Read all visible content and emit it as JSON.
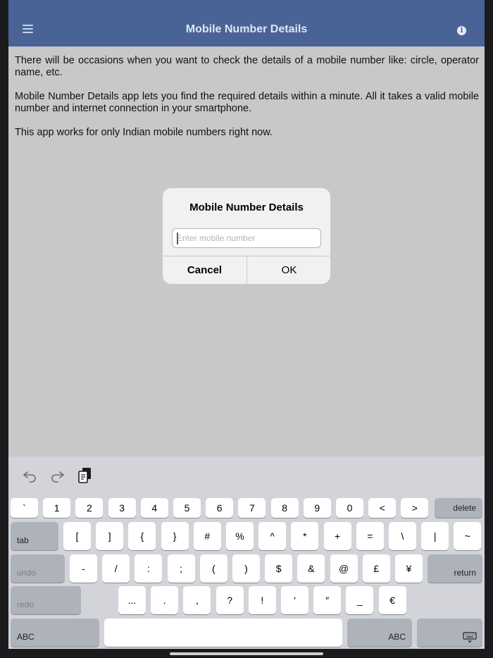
{
  "header": {
    "title": "Mobile Number Details"
  },
  "content": {
    "paragraphs": [
      "There will be occasions when you want to check the details of a mobile number like: circle, operator name, etc.",
      "Mobile Number Details app lets you find the required details within a minute. All it takes a valid mobile number and internet connection in your smartphone.",
      "This app works for only Indian mobile numbers right now."
    ]
  },
  "dialog": {
    "title": "Mobile Number Details",
    "input_value": "",
    "input_placeholder": "Enter mobile number",
    "cancel_label": "Cancel",
    "ok_label": "OK"
  },
  "keyboard": {
    "row1": [
      "`",
      "1",
      "2",
      "3",
      "4",
      "5",
      "6",
      "7",
      "8",
      "9",
      "0",
      "<",
      ">"
    ],
    "delete_label": "delete",
    "tab_label": "tab",
    "row2": [
      "[",
      "]",
      "{",
      "}",
      "#",
      "%",
      "^",
      "*",
      "+",
      "=",
      "\\",
      "|",
      "~"
    ],
    "undo_label": "undo",
    "row3": [
      "-",
      "/",
      ":",
      ";",
      "(",
      ")",
      "$",
      "&",
      "@",
      "£",
      "¥"
    ],
    "return_label": "return",
    "redo_label": "redo",
    "row4": [
      "...",
      ".",
      ",",
      "?",
      "!",
      "′",
      "″",
      "_",
      "€"
    ],
    "abc_left_label": "ABC",
    "abc_right_label": "ABC"
  },
  "colors": {
    "header": "#4a6397",
    "screen_bg": "#c8c8c8",
    "keyboard_bg": "#d2d4da"
  },
  "icons": {
    "menu": "hamburger-menu-icon",
    "info": "info-icon",
    "undo": "undo-arrow-icon",
    "redo": "redo-arrow-icon",
    "paste": "clipboard-paste-icon",
    "dismiss": "keyboard-dismiss-icon"
  }
}
